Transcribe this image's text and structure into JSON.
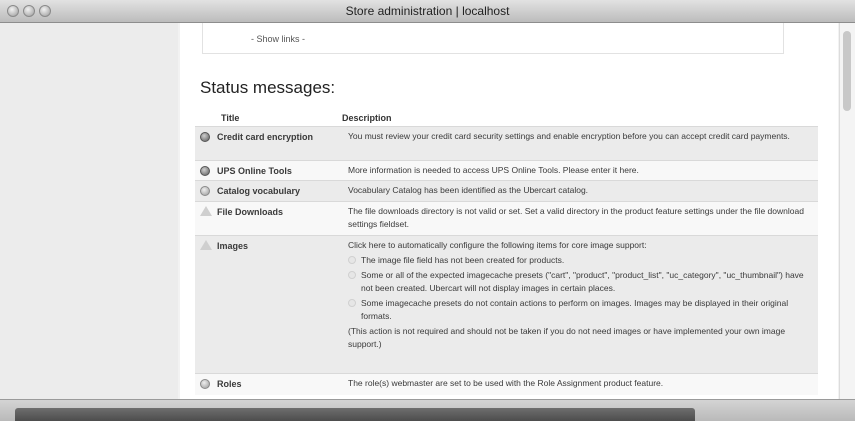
{
  "window": {
    "title": "Store administration | localhost"
  },
  "page": {
    "show_links": "- Show links -",
    "status_heading": "Status messages:",
    "table": {
      "headers": {
        "title": "Title",
        "description": "Description"
      },
      "rows": [
        {
          "icon": "grey-status-dot-icon",
          "title": "Credit card encryption",
          "description": "You must review your credit card security settings and enable encryption before you can accept credit card payments."
        },
        {
          "icon": "grey-status-dot-icon",
          "title": "UPS Online Tools",
          "description": "More information is needed to access UPS Online Tools. Please enter it here."
        },
        {
          "icon": "light-status-dot-icon",
          "title": "Catalog vocabulary",
          "description": "Vocabulary Catalog has been identified as the Ubercart catalog."
        },
        {
          "icon": "warning-triangle-icon",
          "title": "File Downloads",
          "description": "The file downloads directory is not valid or set. Set a valid directory in the product feature settings under the file download settings fieldset."
        },
        {
          "icon": "warning-triangle-icon",
          "title": "Images",
          "description": "Click here to automatically configure the following items for core image support:",
          "items": [
            "The image file field has not been created for products.",
            "Some or all of the expected imagecache presets (\"cart\", \"product\", \"product_list\", \"uc_category\", \"uc_thumbnail\") have not been created. Ubercart will not display images in certain places.",
            "Some imagecache presets do not contain actions to perform on images. Images may be displayed in their original formats."
          ],
          "note": "(This action is not required and should not be taken if you do not need images or have implemented your own image support.)"
        },
        {
          "icon": "light-status-dot-icon",
          "title": "Roles",
          "description": "The role(s) webmaster are set to be used with the Role Assignment product feature."
        }
      ]
    }
  }
}
